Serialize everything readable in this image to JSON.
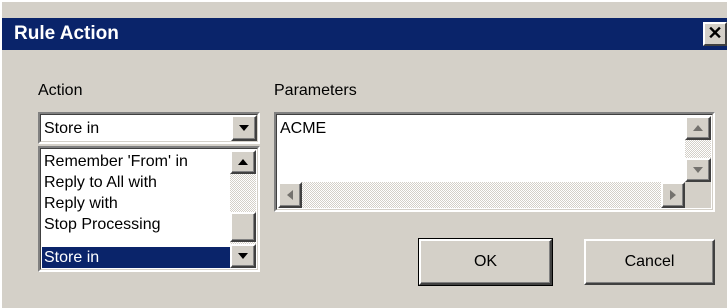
{
  "window": {
    "title": "Rule Action",
    "close_glyph": "✕"
  },
  "action": {
    "label": "Action",
    "selected_value": "Store in",
    "list_items": [
      "Remember 'From' in",
      "Reply to All with",
      "Reply with",
      "Stop Processing",
      "Store in"
    ],
    "selected_index": 4
  },
  "parameters": {
    "label": "Parameters",
    "value": "ACME"
  },
  "buttons": {
    "ok": "OK",
    "cancel": "Cancel"
  },
  "colors": {
    "face": "#d4d0c8",
    "title_bar": "#0a246a",
    "selection": "#0a246a"
  }
}
